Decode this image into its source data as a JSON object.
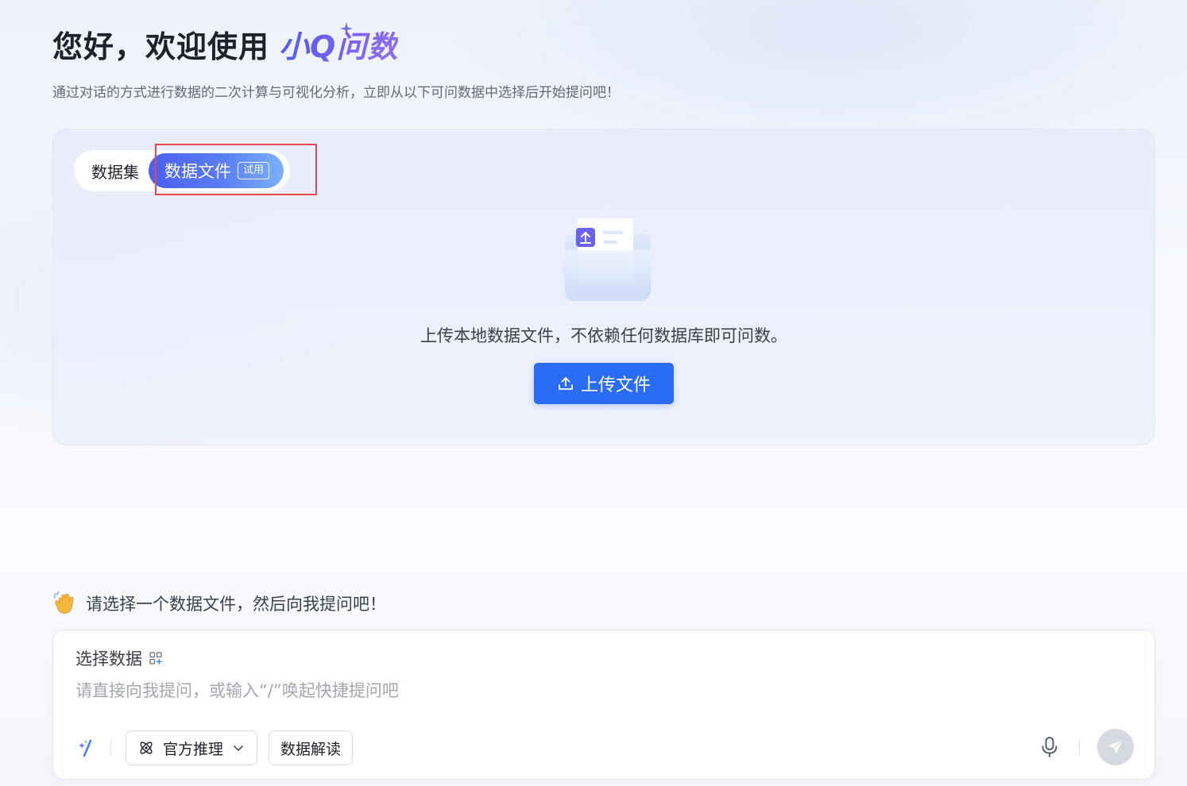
{
  "header": {
    "greeting": "您好，欢迎使用",
    "brand": "小Q问数",
    "subtitle": "通过对话的方式进行数据的二次计算与可视化分析，立即从以下可问数据中选择后开始提问吧！"
  },
  "tabs": {
    "dataset": "数据集",
    "datafile": "数据文件",
    "trial_badge": "试用"
  },
  "empty_state": {
    "text": "上传本地数据文件，不依赖任何数据库即可问数。",
    "upload_button": "上传文件"
  },
  "prompt": {
    "text": "请选择一个数据文件，然后向我提问吧！"
  },
  "composer": {
    "select_data_label": "选择数据",
    "placeholder": "请直接向我提问，或输入“/”唤起快捷提问吧",
    "value": "",
    "model_select": "官方推理",
    "chip_label": "数据解读"
  },
  "colors": {
    "accent": "#2b6cf6",
    "brand_gradient_start": "#4f5cf0",
    "brand_gradient_end": "#8a6cf7",
    "highlight": "#e5484d",
    "send_disabled": "#d6d9df"
  },
  "icons": [
    "sparkle-icon",
    "upload-folder-illustration",
    "upload-icon",
    "waving-hand-icon",
    "grid-icon",
    "magic-wand-icon",
    "atom-icon",
    "chevron-down-icon",
    "microphone-icon",
    "send-icon"
  ]
}
